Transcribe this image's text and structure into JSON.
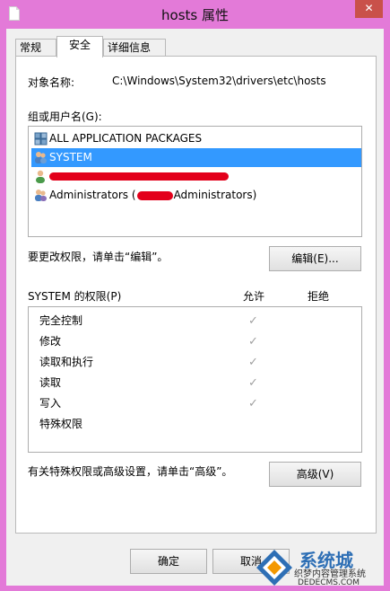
{
  "window": {
    "title": "hosts 属性",
    "close_glyph": "✕"
  },
  "tabs": [
    {
      "label": "常规"
    },
    {
      "label": "安全"
    },
    {
      "label": "详细信息"
    }
  ],
  "object": {
    "label": "对象名称:",
    "value": "C:\\Windows\\System32\\drivers\\etc\\hosts"
  },
  "groups": {
    "label": "组或用户名(G):",
    "items": [
      {
        "label": "ALL APPLICATION PACKAGES",
        "icon": "packages-icon"
      },
      {
        "label": "SYSTEM",
        "icon": "users-icon",
        "selected": true
      },
      {
        "label": "",
        "icon": "user-icon",
        "redacted": true
      },
      {
        "label": "Administrators (",
        "suffix": "Administrators)",
        "icon": "users-icon"
      }
    ]
  },
  "change_hint": "要更改权限，请单击“编辑”。",
  "edit_button": "编辑(E)...",
  "permissions": {
    "header": "SYSTEM 的权限(P)",
    "allow": "允许",
    "deny": "拒绝",
    "check_glyph": "✓",
    "rows": [
      {
        "name": "完全控制",
        "allow": true,
        "deny": false
      },
      {
        "name": "修改",
        "allow": true,
        "deny": false
      },
      {
        "name": "读取和执行",
        "allow": true,
        "deny": false
      },
      {
        "name": "读取",
        "allow": true,
        "deny": false
      },
      {
        "name": "写入",
        "allow": true,
        "deny": false
      },
      {
        "name": "特殊权限",
        "allow": false,
        "deny": false
      }
    ]
  },
  "advanced_hint": "有关特殊权限或高级设置，请单击“高级”。",
  "advanced_button": "高级(V)",
  "footer": {
    "ok": "确定",
    "cancel": "取消"
  },
  "watermark": {
    "line1": "系统城",
    "line2": "织梦内容管理系统",
    "line3": "DEDECMS.COM"
  },
  "colors": {
    "titlebar": "#e37ad8",
    "selection": "#3399ff",
    "close": "#c9514a"
  }
}
